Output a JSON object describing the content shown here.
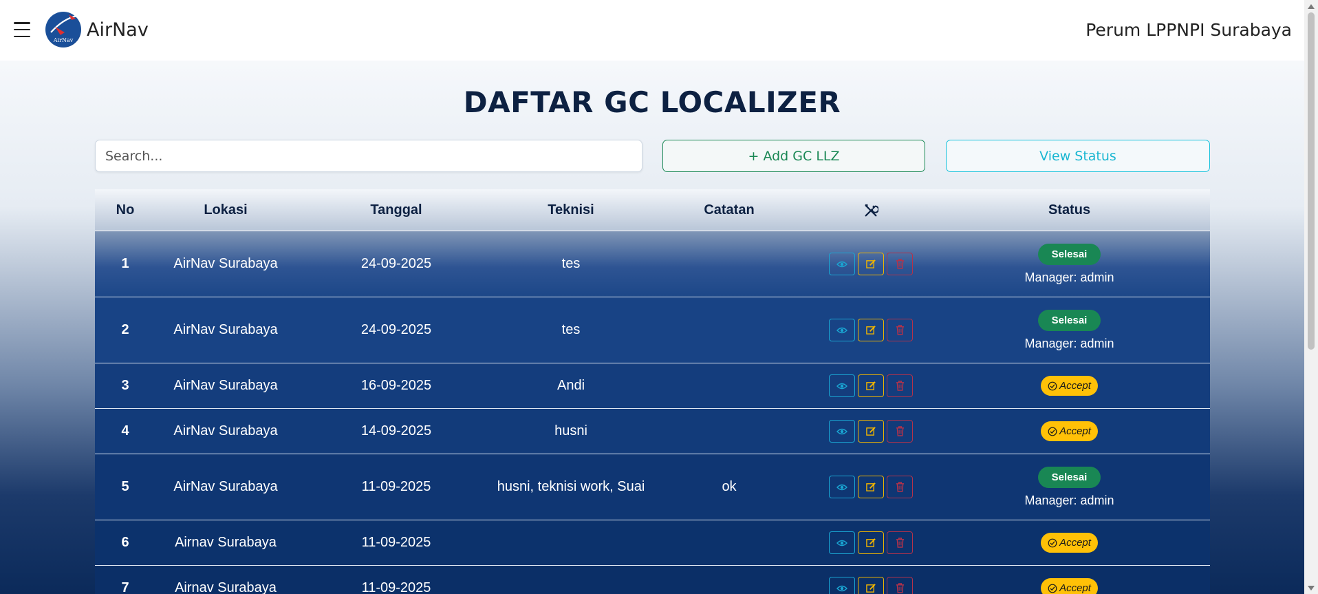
{
  "navbar": {
    "brand": "AirNav",
    "logo_text": "AirNav",
    "organization": "Perum LPPNPI Surabaya"
  },
  "page_title": "DAFTAR GC LOCALIZER",
  "toolbar": {
    "search_placeholder": "Search...",
    "add_label": "+ Add GC LLZ",
    "view_status_label": "View Status"
  },
  "table": {
    "headers": {
      "no": "No",
      "lokasi": "Lokasi",
      "tanggal": "Tanggal",
      "teknisi": "Teknisi",
      "catatan": "Catatan",
      "status": "Status"
    },
    "rows": [
      {
        "no": "1",
        "lokasi": "AirNav Surabaya",
        "tanggal": "24-09-2025",
        "teknisi": "tes",
        "catatan": "",
        "status": "Selesai",
        "manager": "Manager: admin"
      },
      {
        "no": "2",
        "lokasi": "AirNav Surabaya",
        "tanggal": "24-09-2025",
        "teknisi": "tes",
        "catatan": "",
        "status": "Selesai",
        "manager": "Manager: admin"
      },
      {
        "no": "3",
        "lokasi": "AirNav Surabaya",
        "tanggal": "16-09-2025",
        "teknisi": "Andi",
        "catatan": "",
        "status": "Accept",
        "manager": ""
      },
      {
        "no": "4",
        "lokasi": "AirNav Surabaya",
        "tanggal": "14-09-2025",
        "teknisi": "husni",
        "catatan": "",
        "status": "Accept",
        "manager": ""
      },
      {
        "no": "5",
        "lokasi": "AirNav Surabaya",
        "tanggal": "11-09-2025",
        "teknisi": "husni, teknisi work, Suai",
        "catatan": "ok",
        "status": "Selesai",
        "manager": "Manager: admin"
      },
      {
        "no": "6",
        "lokasi": "Airnav Surabaya",
        "tanggal": "11-09-2025",
        "teknisi": "",
        "catatan": "",
        "status": "Accept",
        "manager": ""
      },
      {
        "no": "7",
        "lokasi": "Airnav Surabaya",
        "tanggal": "11-09-2025",
        "teknisi": "",
        "catatan": "",
        "status": "Accept",
        "manager": ""
      }
    ]
  },
  "colors": {
    "title": "#0d2142",
    "success": "#198754",
    "accept": "#ffc107",
    "info": "#1aa6d3",
    "warning": "#f0b400",
    "danger": "#b4324a"
  },
  "icons": [
    "menu-icon",
    "airnav-logo",
    "tools-icon",
    "eye-icon",
    "edit-icon",
    "trash-icon",
    "check-circle-icon"
  ]
}
